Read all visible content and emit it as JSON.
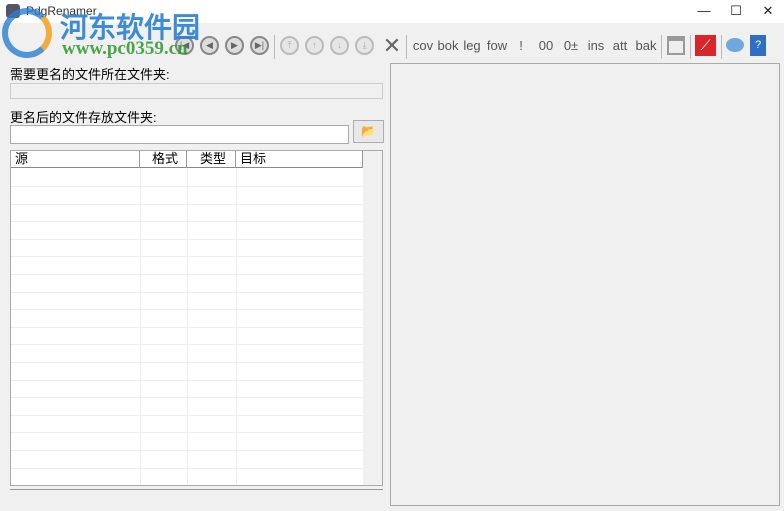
{
  "window": {
    "title": "PdgRenamer",
    "minimize": "—",
    "maximize": "☐",
    "close": "✕"
  },
  "toolbar": {
    "text_buttons": [
      "cov",
      "bok",
      "leg",
      "fow",
      "!",
      "00",
      "0±",
      "ins",
      "att",
      "bak"
    ],
    "nav_icons": [
      "first-icon",
      "prev-icon",
      "next-icon",
      "last-icon"
    ],
    "move_icons": [
      "move-top-icon",
      "move-up-icon",
      "move-down-icon",
      "move-bottom-icon"
    ]
  },
  "source_folder": {
    "label": "需要更名的文件所在文件夹:",
    "value": ""
  },
  "target_folder": {
    "label": "更名后的文件存放文件夹:",
    "value": "",
    "browse_icon": "📂"
  },
  "table": {
    "columns": [
      "源",
      "格式",
      "类型",
      "目标"
    ],
    "rows": []
  },
  "watermark": {
    "name": "河东软件园",
    "url": "www.pc0359.cn"
  }
}
